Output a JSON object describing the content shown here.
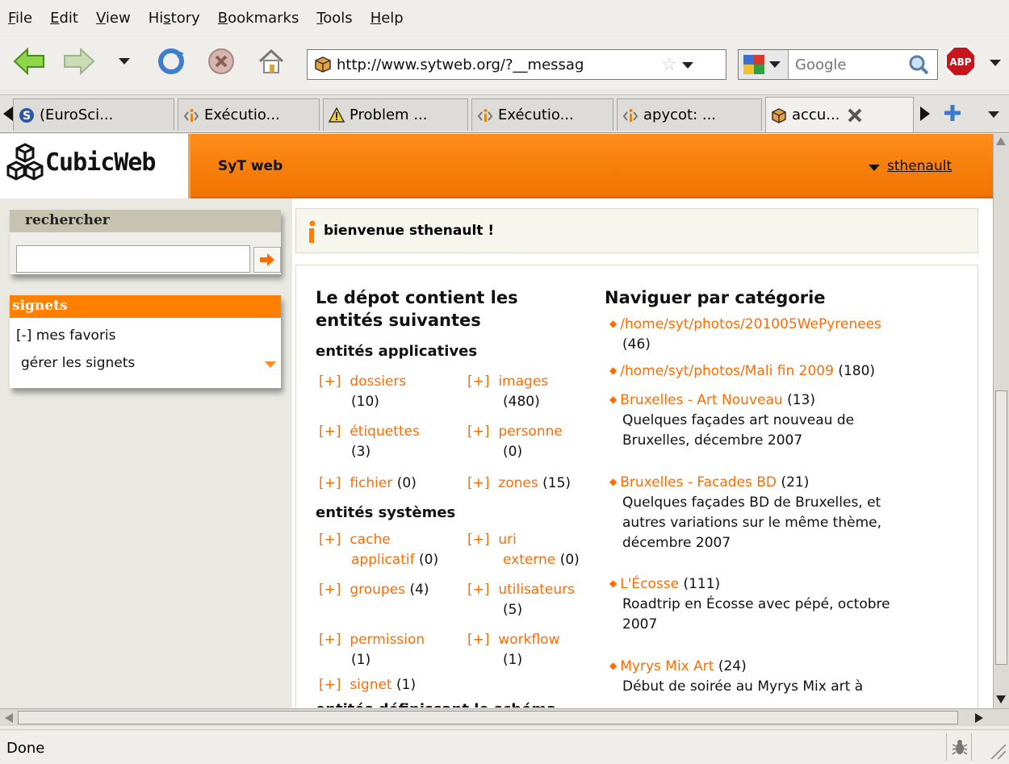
{
  "menubar": {
    "items": [
      {
        "pre": "",
        "u": "F",
        "post": "ile"
      },
      {
        "pre": "",
        "u": "E",
        "post": "dit"
      },
      {
        "pre": "",
        "u": "V",
        "post": "iew"
      },
      {
        "pre": "Hi",
        "u": "s",
        "post": "tory"
      },
      {
        "pre": "",
        "u": "B",
        "post": "ookmarks"
      },
      {
        "pre": "",
        "u": "T",
        "post": "ools"
      },
      {
        "pre": "",
        "u": "H",
        "post": "elp"
      }
    ]
  },
  "navbar": {
    "url": "http://www.sytweb.org/?__messag",
    "search_placeholder": "Google"
  },
  "tabs": [
    {
      "label": "(EuroSci...",
      "icon": "euroscipy-icon"
    },
    {
      "label": "Exécutio...",
      "icon": "apycot-icon"
    },
    {
      "label": "Problem ...",
      "icon": "warning-icon"
    },
    {
      "label": "Exécutio...",
      "icon": "apycot-icon"
    },
    {
      "label": "apycot: ...",
      "icon": "apycot-icon"
    },
    {
      "label": "accu...",
      "icon": "cube-icon"
    }
  ],
  "cw": {
    "logo": "CubicWeb",
    "site_name": "SyT web",
    "user": "sthenault",
    "search_title": "rechercher",
    "bookmarks_title": "signets",
    "bookmarks": [
      "[-] mes favoris",
      "gérer les signets"
    ],
    "welcome": "bienvenue sthenault !",
    "left_heading_line1": "Le dépot contient les",
    "left_heading_line2": "entités suivantes",
    "applicative_title": "entités applicatives",
    "applicative": [
      {
        "plus": "[+]",
        "name": "dossiers",
        "count": "(10)"
      },
      {
        "plus": "[+]",
        "name": "images",
        "count": "(480)"
      },
      {
        "plus": "[+]",
        "name": "étiquettes",
        "count": "(3)"
      },
      {
        "plus": "[+]",
        "name": "personne",
        "count": "(0)"
      },
      {
        "plus": "[+]",
        "name": "fichier",
        "count": "(0)"
      },
      {
        "plus": "[+]",
        "name": "zones",
        "count": "(15)"
      }
    ],
    "system_title": "entités systèmes",
    "system": [
      {
        "plus": "[+]",
        "name1": "cache",
        "name2": "applicatif",
        "count": "(0)"
      },
      {
        "plus": "[+]",
        "name1": "uri",
        "name2": "externe",
        "count": "(0)"
      },
      {
        "plus": "[+]",
        "name": "groupes",
        "count": "(4)"
      },
      {
        "plus": "[+]",
        "name": "utilisateurs",
        "count": "(5)"
      },
      {
        "plus": "[+]",
        "name": "permission",
        "count": "(1)"
      },
      {
        "plus": "[+]",
        "name": "workflow",
        "count": "(1)"
      },
      {
        "plus": "[+]",
        "name": "signet",
        "count": "(1)"
      }
    ],
    "cut_heading": "entités définissant le schéma",
    "right_heading": "Naviguer par catégorie",
    "categories": [
      {
        "name": "/home/syt/photos/201005WePyrenees",
        "count": "(46)",
        "desc": ""
      },
      {
        "name": "/home/syt/photos/Mali fin 2009",
        "count": "(180)",
        "desc": ""
      },
      {
        "name": "Bruxelles - Art Nouveau",
        "count": "(13)",
        "desc1": "Quelques façades art nouveau de",
        "desc2": "Bruxelles, décembre 2007"
      },
      {
        "name": "Bruxelles - Facades BD",
        "count": "(21)",
        "desc1": "Quelques façades BD de Bruxelles, et",
        "desc2": "autres variations sur le même thème,",
        "desc3": "décembre 2007"
      },
      {
        "name": "L'Écosse",
        "count": "(111)",
        "desc1": "Roadtrip en Écosse avec pépé, octobre",
        "desc2": "2007"
      },
      {
        "name": "Myrys Mix Art",
        "count": "(24)",
        "desc1": "Début de soirée au Myrys Mix art à"
      }
    ]
  },
  "status": "Done"
}
